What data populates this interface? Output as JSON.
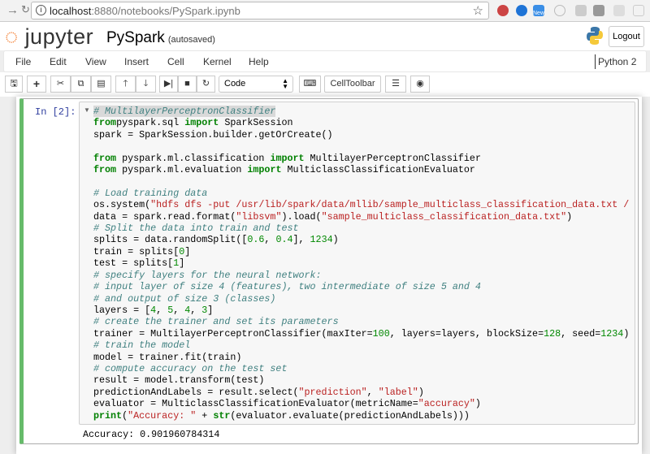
{
  "browser": {
    "url_host": "localhost",
    "url_rest": ":8880/notebooks/PySpark.ipynb",
    "ext_new_badge": "New"
  },
  "header": {
    "logo": "jupyter",
    "notebook_name": "PySpark",
    "autosave": "(autosaved)",
    "logout": "Logout"
  },
  "menu": [
    "File",
    "Edit",
    "View",
    "Insert",
    "Cell",
    "Kernel",
    "Help"
  ],
  "kernel": "Python 2",
  "toolbar": {
    "cell_type": "Code",
    "celltoolbar": "CellToolbar"
  },
  "cell": {
    "prompt": "In [2]:",
    "lines": [
      [
        [
          "c",
          "# MultilayerPerceptronClassifier"
        ]
      ],
      [
        [
          "k",
          "from"
        ],
        [
          "",
          "pyspark.sql "
        ],
        [
          "k",
          "import"
        ],
        [
          "",
          " SparkSession"
        ]
      ],
      [
        [
          "",
          "spark = SparkSession.builder.getOrCreate()"
        ]
      ],
      [
        [
          "",
          ""
        ]
      ],
      [
        [
          "k",
          "from"
        ],
        [
          "",
          " pyspark.ml.classification "
        ],
        [
          "k",
          "import"
        ],
        [
          "",
          " MultilayerPerceptronClassifier"
        ]
      ],
      [
        [
          "k",
          "from"
        ],
        [
          "",
          " pyspark.ml.evaluation "
        ],
        [
          "k",
          "import"
        ],
        [
          "",
          " MulticlassClassificationEvaluator"
        ]
      ],
      [
        [
          "",
          ""
        ]
      ],
      [
        [
          "c",
          "# Load training data"
        ]
      ],
      [
        [
          "",
          "os.system("
        ],
        [
          "s",
          "\"hdfs dfs -put /usr/lib/spark/data/mllib/sample_multiclass_classification_data.txt /"
        ]
      ],
      [
        [
          "",
          "data = spark.read.format("
        ],
        [
          "s",
          "\"libsvm\""
        ],
        [
          "",
          ").load("
        ],
        [
          "s",
          "\"sample_multiclass_classification_data.txt\""
        ],
        [
          "",
          ")"
        ]
      ],
      [
        [
          "c",
          "# Split the data into train and test"
        ]
      ],
      [
        [
          "",
          "splits = data.randomSplit(["
        ],
        [
          "n",
          "0.6"
        ],
        [
          "",
          ", "
        ],
        [
          "n",
          "0.4"
        ],
        [
          "",
          "], "
        ],
        [
          "n",
          "1234"
        ],
        [
          "",
          ")"
        ]
      ],
      [
        [
          "",
          "train = splits["
        ],
        [
          "n",
          "0"
        ],
        [
          "",
          "]"
        ]
      ],
      [
        [
          "",
          "test = splits["
        ],
        [
          "n",
          "1"
        ],
        [
          "",
          "]"
        ]
      ],
      [
        [
          "c",
          "# specify layers for the neural network:"
        ]
      ],
      [
        [
          "c",
          "# input layer of size 4 (features), two intermediate of size 5 and 4"
        ]
      ],
      [
        [
          "c",
          "# and output of size 3 (classes)"
        ]
      ],
      [
        [
          "",
          "layers = ["
        ],
        [
          "n",
          "4"
        ],
        [
          "",
          ", "
        ],
        [
          "n",
          "5"
        ],
        [
          "",
          ", "
        ],
        [
          "n",
          "4"
        ],
        [
          "",
          ", "
        ],
        [
          "n",
          "3"
        ],
        [
          "",
          "]"
        ]
      ],
      [
        [
          "c",
          "# create the trainer and set its parameters"
        ]
      ],
      [
        [
          "",
          "trainer = MultilayerPerceptronClassifier(maxIter="
        ],
        [
          "n",
          "100"
        ],
        [
          "",
          ", layers=layers, blockSize="
        ],
        [
          "n",
          "128"
        ],
        [
          "",
          ", seed="
        ],
        [
          "n",
          "1234"
        ],
        [
          "",
          ")"
        ]
      ],
      [
        [
          "c",
          "# train the model"
        ]
      ],
      [
        [
          "",
          "model = trainer.fit(train)"
        ]
      ],
      [
        [
          "c",
          "# compute accuracy on the test set"
        ]
      ],
      [
        [
          "",
          "result = model.transform(test)"
        ]
      ],
      [
        [
          "",
          "predictionAndLabels = result.select("
        ],
        [
          "s",
          "\"prediction\""
        ],
        [
          "",
          ", "
        ],
        [
          "s",
          "\"label\""
        ],
        [
          "",
          ")"
        ]
      ],
      [
        [
          "",
          "evaluator = MulticlassClassificationEvaluator(metricName="
        ],
        [
          "s",
          "\"accuracy\""
        ],
        [
          "",
          ")"
        ]
      ],
      [
        [
          "k",
          "print"
        ],
        [
          "",
          "("
        ],
        [
          "s",
          "\"Accuracy: \""
        ],
        [
          "",
          " + "
        ],
        [
          "k",
          "str"
        ],
        [
          "",
          "(evaluator.evaluate(predictionAndLabels)))"
        ]
      ]
    ]
  },
  "output": "Accuracy: 0.901960784314"
}
